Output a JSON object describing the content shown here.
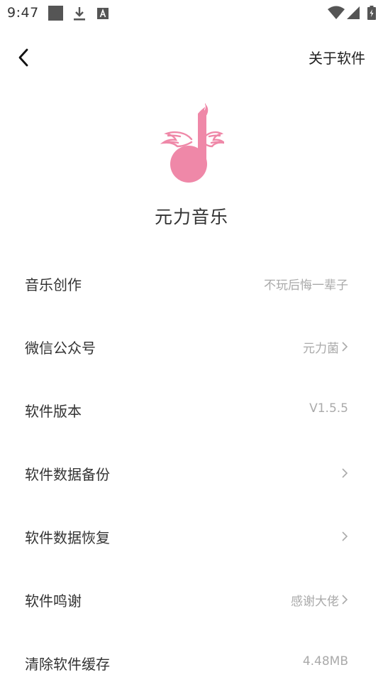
{
  "status_bar": {
    "time": "9:47",
    "icons": [
      "square-notification-icon",
      "download-icon",
      "a-notification-icon",
      "wifi-icon",
      "signal-icon",
      "battery-icon"
    ]
  },
  "header": {
    "title": "关于软件",
    "back_icon": "chevron-left-icon"
  },
  "app": {
    "name": "元力音乐",
    "logo": "winged-music-note-logo",
    "logo_color": "#ef88a8"
  },
  "settings": [
    {
      "label": "音乐创作",
      "value": "不玩后悔一辈子",
      "chevron": false
    },
    {
      "label": "微信公众号",
      "value": "元力菌",
      "chevron": true
    },
    {
      "label": "软件版本",
      "value": "V1.5.5",
      "chevron": false
    },
    {
      "label": "软件数据备份",
      "value": "",
      "chevron": true
    },
    {
      "label": "软件数据恢复",
      "value": "",
      "chevron": true
    },
    {
      "label": "软件鸣谢",
      "value": "感谢大佬",
      "chevron": true
    },
    {
      "label": "清除软件缓存",
      "value": "4.48MB",
      "chevron": false
    }
  ],
  "colors": {
    "accent": "#ef88a8",
    "label_text": "#333333",
    "value_text": "#aaaaaa"
  }
}
